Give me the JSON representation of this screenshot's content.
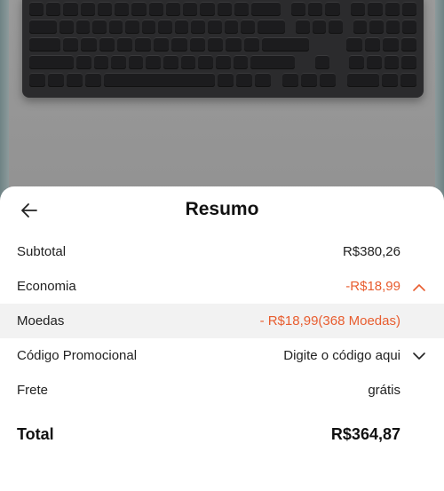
{
  "sheet": {
    "title": "Resumo",
    "back_icon": "arrow-left-icon"
  },
  "summary": {
    "subtotal": {
      "label": "Subtotal",
      "value": "R$380,26"
    },
    "economia": {
      "label": "Economia",
      "value": "-R$18,99",
      "icon": "chevron-up-icon"
    },
    "moedas": {
      "label": "Moedas",
      "value": "- R$18,99(368 Moedas)"
    },
    "promo": {
      "label": "Código Promocional",
      "value": "Digite o código aqui",
      "icon": "chevron-down-icon"
    },
    "frete": {
      "label": "Frete",
      "value": "grátis"
    },
    "total": {
      "label": "Total",
      "value": "R$364,87"
    }
  },
  "colors": {
    "accent": "#e85d2f",
    "text": "#222222",
    "shaded_row": "#f2f2f2",
    "overlay": "#8f8f8f"
  }
}
